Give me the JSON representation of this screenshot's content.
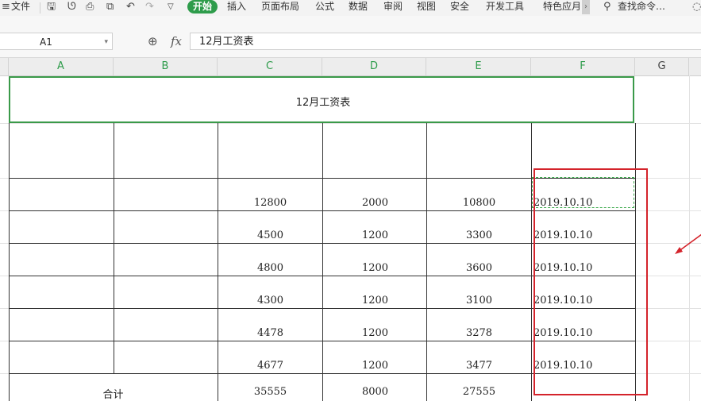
{
  "ribbon": {
    "menu_icon": "≡",
    "file_label": "文件",
    "tabs": [
      "开始",
      "插入",
      "页面布局",
      "公式",
      "数据",
      "审阅",
      "视图",
      "安全",
      "开发工具",
      "特色应月"
    ],
    "search_label": "查找命令…",
    "icons": [
      "save-icon",
      "format-painter-icon",
      "print-icon",
      "print-preview-icon",
      "undo-icon",
      "redo-icon",
      "dropdown-icon",
      "search-icon"
    ],
    "active_tab_color": "#2e9c4b"
  },
  "formula_bar": {
    "name_box": "A1",
    "fx_label": "fx",
    "formula": "12月工资表"
  },
  "columns": [
    "A",
    "B",
    "C",
    "D",
    "E",
    "F",
    "G"
  ],
  "sheet": {
    "title": "12月工资表",
    "rows": [
      {
        "c": "12800",
        "d": "2000",
        "e": "10800",
        "f": "2019.10.10"
      },
      {
        "c": "4500",
        "d": "1200",
        "e": "3300",
        "f": "2019.10.10"
      },
      {
        "c": "4800",
        "d": "1200",
        "e": "3600",
        "f": "2019.10.10"
      },
      {
        "c": "4300",
        "d": "1200",
        "e": "3100",
        "f": "2019.10.10"
      },
      {
        "c": "4478",
        "d": "1200",
        "e": "3278",
        "f": "2019.10.10"
      },
      {
        "c": "4677",
        "d": "1200",
        "e": "3477",
        "f": "2019.10.10"
      }
    ],
    "total": {
      "label": "合计",
      "c": "35555",
      "d": "8000",
      "e": "27555"
    }
  },
  "annotation_color": "#d4232b"
}
